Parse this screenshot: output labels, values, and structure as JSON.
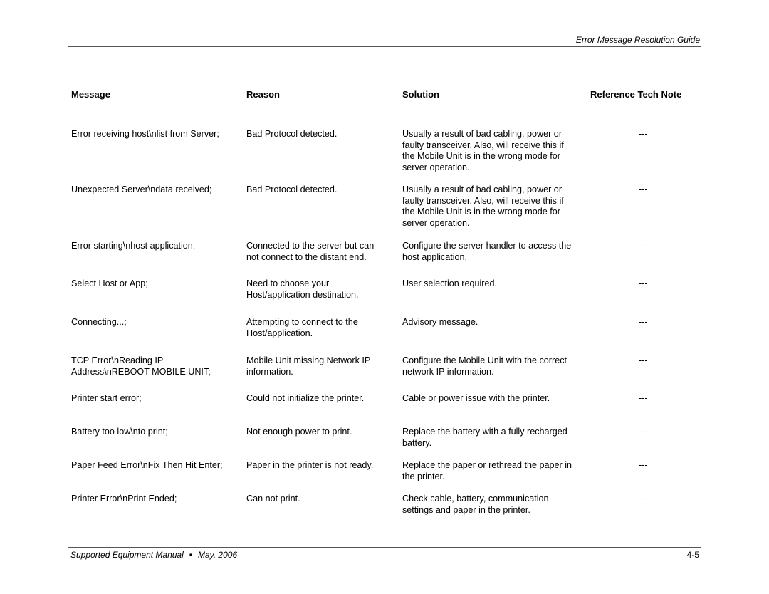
{
  "header": {
    "title": "Error Message Resolution Guide"
  },
  "table": {
    "columns": [
      "Message",
      "Reason",
      "Solution",
      "Reference Tech Note"
    ],
    "rows": [
      {
        "message": [
          "Error receiving host\\nlist from Server;"
        ],
        "reason": [
          "Bad Protocol detected."
        ],
        "solution": [
          "Usually a result of bad cabling, power or",
          "faulty transceiver. Also, will receive this if",
          "the Mobile Unit is in the wrong mode for",
          "server operation."
        ],
        "reference": "---"
      },
      {
        "message": [
          "Unexpected Server\\ndata received;"
        ],
        "reason": [
          "Bad Protocol detected."
        ],
        "solution": [
          "Usually a result of bad cabling, power or",
          "faulty transceiver. Also, will receive this if",
          "the Mobile Unit is in the wrong mode for",
          "server operation."
        ],
        "reference": "---"
      },
      {
        "message": [
          "Error starting\\nhost application;"
        ],
        "reason": [
          "Connected to the server but can",
          "not connect to the distant end."
        ],
        "solution": [
          "Configure the server handler to access the",
          "host application."
        ],
        "reference": "---"
      },
      {
        "message": [
          "Select Host or App;"
        ],
        "reason": [
          "Need to choose your",
          "Host/application destination."
        ],
        "solution": [
          "User selection required."
        ],
        "reference": "---"
      },
      {
        "message": [
          "Connecting...;"
        ],
        "reason": [
          "Attempting to connect to the",
          "Host/application."
        ],
        "solution": [
          "Advisory message."
        ],
        "reference": "---"
      },
      {
        "message": [
          "TCP Error\\nReading IP",
          "Address\\nREBOOT MOBILE UNIT;"
        ],
        "reason": [
          "Mobile Unit missing Network IP",
          "information."
        ],
        "solution": [
          "Configure the Mobile Unit with the correct",
          "network IP information."
        ],
        "reference": "---"
      },
      {
        "message": [
          "Printer start error;"
        ],
        "reason": [
          "Could not initialize the printer."
        ],
        "solution": [
          "Cable or power issue with the printer."
        ],
        "reference": "---"
      },
      {
        "message": [
          "Battery too low\\nto print;"
        ],
        "reason": [
          "Not enough power to print."
        ],
        "solution": [
          "Replace the battery with a fully recharged",
          "battery."
        ],
        "reference": "---"
      },
      {
        "message": [
          "Paper Feed Error\\nFix Then Hit Enter;"
        ],
        "reason": [
          "Paper in the printer is not ready."
        ],
        "solution": [
          "Replace the paper or rethread the paper in",
          "the printer."
        ],
        "reference": "---"
      },
      {
        "message": [
          "Printer Error\\nPrint Ended;"
        ],
        "reason": [
          "Can not print."
        ],
        "solution": [
          "Check cable, battery, communication",
          "settings and paper in the printer."
        ],
        "reference": "---"
      }
    ]
  },
  "footer": {
    "manual": "Supported Equipment Manual",
    "bullet": "•",
    "date": "May, 2006",
    "page_number": "4-5"
  }
}
